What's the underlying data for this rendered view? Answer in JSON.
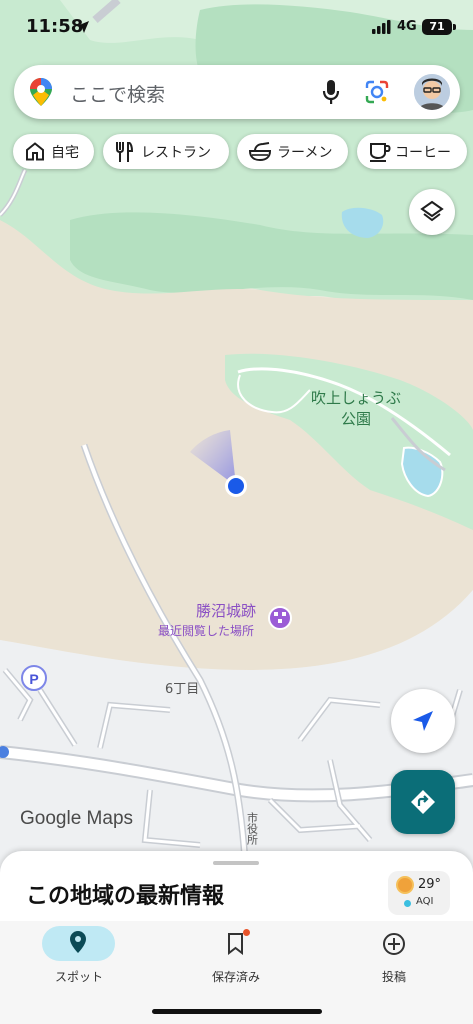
{
  "status_bar": {
    "time": "11:58",
    "network": "4G",
    "battery": "71"
  },
  "search": {
    "placeholder": "ここで検索"
  },
  "chips": [
    {
      "label": "自宅",
      "icon": "home-icon"
    },
    {
      "label": "レストラン",
      "icon": "fork-knife-icon"
    },
    {
      "label": "ラーメン",
      "icon": "ramen-bowl-icon"
    },
    {
      "label": "コーヒー",
      "icon": "coffee-cup-icon"
    }
  ],
  "map": {
    "park_name": "吹上しょうぶ\n公園",
    "park_line1": "吹上しょうぶ",
    "park_line2": "公園",
    "place_name": "勝沼城跡",
    "place_sub": "最近閲覧した場所",
    "area_label": "6丁目",
    "road_label": "市役所",
    "attribution": "Google Maps",
    "colors": {
      "land": "#f0ebe0",
      "green": "#cdebd4",
      "water": "#a6dcec",
      "road": "#ffffff",
      "road_edge": "#c9cdd3",
      "accent": "#0b6e78"
    }
  },
  "bottom_sheet": {
    "title": "この地域の最新情報",
    "weather": {
      "temp": "29°",
      "aqi": "AQI"
    }
  },
  "tabs": [
    {
      "label": "スポット",
      "icon": "location-pin-icon",
      "active": true
    },
    {
      "label": "保存済み",
      "icon": "bookmark-icon",
      "active": false
    },
    {
      "label": "投稿",
      "icon": "add-circle-icon",
      "active": false
    }
  ]
}
